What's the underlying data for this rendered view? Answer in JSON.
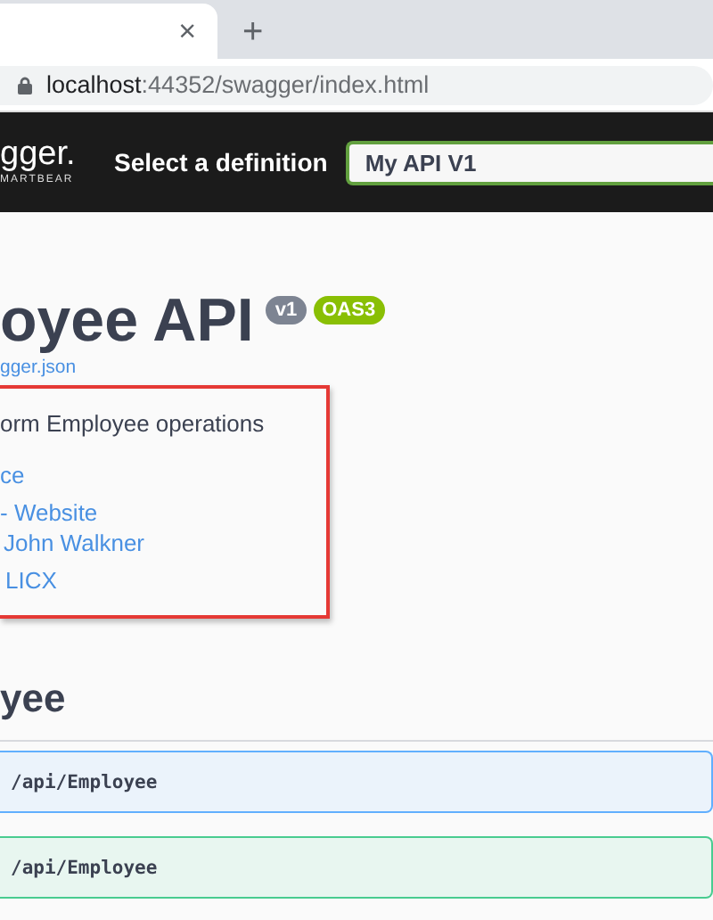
{
  "browser": {
    "tab": {
      "close": "×"
    },
    "new_tab": "+",
    "address": {
      "host": "localhost",
      "rest": ":44352/swagger/index.html"
    }
  },
  "topbar": {
    "logo": "gger.",
    "logo_sub": "MARTBEAR",
    "select_label": "Select a definition",
    "definition": "My API V1"
  },
  "info": {
    "title": "oyee API",
    "version": "v1",
    "oas": "OAS3",
    "spec_link": "gger.json",
    "description": "orm Employee operations",
    "links": [
      "ce",
      "- Website",
      "John Walkner",
      "LICX"
    ]
  },
  "tag": {
    "name": "yee"
  },
  "operations": [
    {
      "kind": "get",
      "path": "/api/Employee"
    },
    {
      "kind": "post",
      "path": "/api/Employee"
    }
  ]
}
